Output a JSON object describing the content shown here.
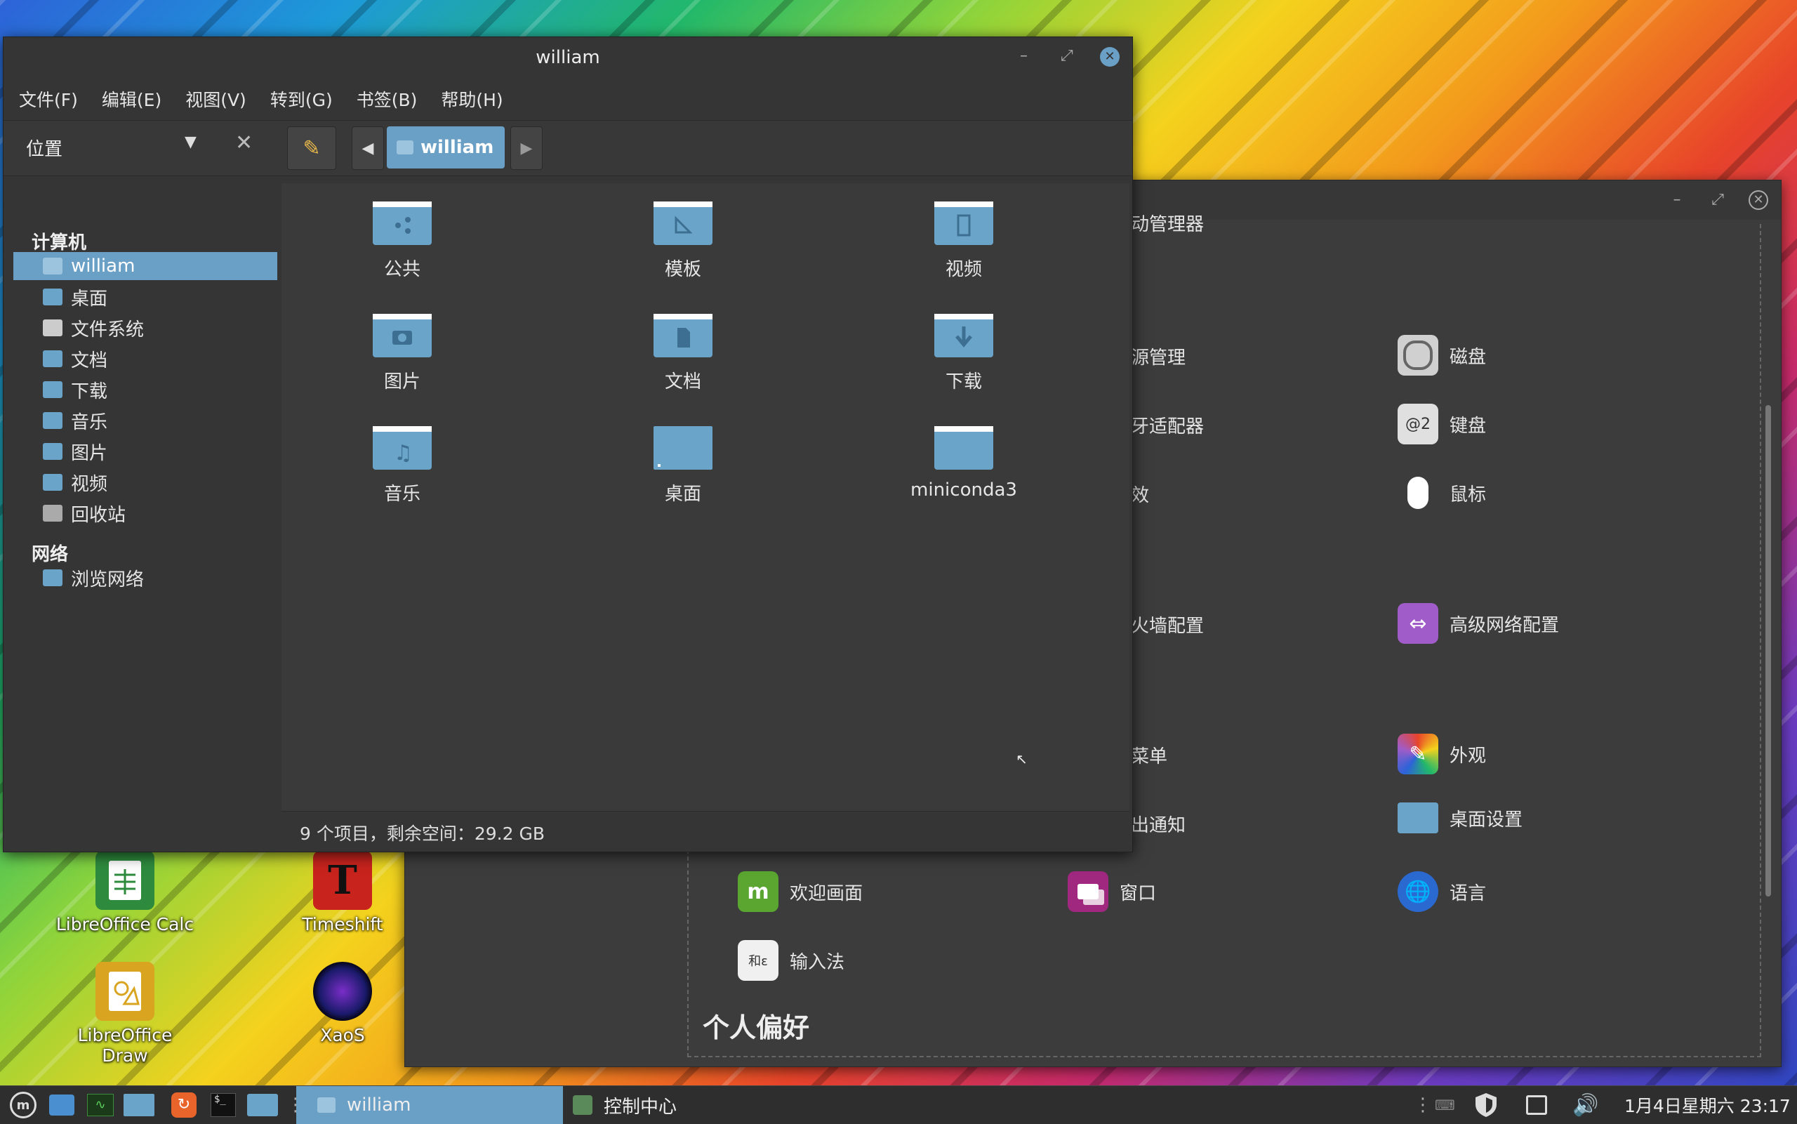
{
  "desktop": {
    "icons": [
      {
        "label": "LibreOffice Calc",
        "color": "#2e8b3e"
      },
      {
        "label": "Timeshift",
        "color": "#c8231d"
      },
      {
        "label": "LibreOffice Draw",
        "color": "#d9a520"
      },
      {
        "label": "XaoS",
        "color": "#1a1a6a"
      }
    ]
  },
  "control_center": {
    "partial_items": [
      "动管理器",
      "源管理",
      "牙适配器",
      "效",
      "火墙配置",
      "菜单",
      "出通知"
    ],
    "items": [
      {
        "label": "磁盘",
        "icon": "disk-icon",
        "color": "#d0d0d0"
      },
      {
        "label": "键盘",
        "icon": "keyboard-icon",
        "color": "#e0e0e0"
      },
      {
        "label": "鼠标",
        "icon": "mouse-icon",
        "color": "#ffffff"
      },
      {
        "label": "高级网络配置",
        "icon": "network-icon",
        "color": "#a05cc8"
      },
      {
        "label": "外观",
        "icon": "appearance-icon",
        "color": "#d0408a"
      },
      {
        "label": "桌面设置",
        "icon": "desktop-settings-icon",
        "color": "#6aa4c8"
      },
      {
        "label": "欢迎画面",
        "icon": "mint-welcome-icon",
        "color": "#5ba631"
      },
      {
        "label": "窗口",
        "icon": "windows-icon",
        "color": "#a0287e"
      },
      {
        "label": "语言",
        "icon": "language-icon",
        "color": "#2a6ad0"
      },
      {
        "label": "输入法",
        "icon": "input-method-icon",
        "color": "#f0f0f0"
      }
    ],
    "section_title": "个人偏好"
  },
  "file_manager": {
    "title": "william",
    "menu": [
      "文件(F)",
      "编辑(E)",
      "视图(V)",
      "转到(G)",
      "书签(B)",
      "帮助(H)"
    ],
    "location_label": "位置",
    "path_button": "william",
    "sidebar": {
      "computer_header": "计算机",
      "computer_items": [
        "william",
        "桌面",
        "文件系统",
        "文档",
        "下载",
        "音乐",
        "图片",
        "视频",
        "回收站"
      ],
      "network_header": "网络",
      "network_items": [
        "浏览网络"
      ]
    },
    "folders": [
      {
        "label": "公共",
        "icon": "share-icon"
      },
      {
        "label": "模板",
        "icon": "template-icon"
      },
      {
        "label": "视频",
        "icon": "video-icon"
      },
      {
        "label": "图片",
        "icon": "camera-icon"
      },
      {
        "label": "文档",
        "icon": "document-icon"
      },
      {
        "label": "下载",
        "icon": "download-icon"
      },
      {
        "label": "音乐",
        "icon": "music-icon"
      },
      {
        "label": "桌面",
        "icon": "desktop-icon"
      },
      {
        "label": "miniconda3",
        "icon": "folder-icon"
      }
    ],
    "status": "9 个项目，剩余空间：29.2 GB"
  },
  "taskbar": {
    "windows": [
      {
        "label": "william",
        "active": true
      },
      {
        "label": "控制中心",
        "active": false
      }
    ],
    "clock": "1月4日星期六 23:17"
  },
  "colors": {
    "accent": "#6a9fc6",
    "folder": "#6aa4c8",
    "window_bg": "#353535"
  }
}
